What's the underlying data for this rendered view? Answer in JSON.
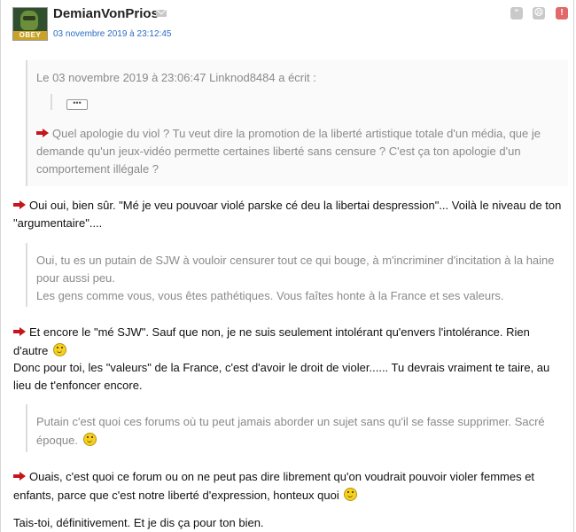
{
  "post": {
    "author": "DemianVonPrios",
    "date": "03 novembre 2019 à 23:12:45",
    "avatar_text": "OBEY",
    "actions": [
      "quote-icon",
      "sad-face-icon",
      "report-icon"
    ],
    "quote1": {
      "header": "Le 03 novembre 2019 à 23:06:47 Linknod8484 a écrit :",
      "collapsed_label": "•••",
      "text": "Quel apologie du viol ? Tu veut dire la promotion de la liberté artistique totale d'un média, que je demande qu'un jeux-vidéo permette certaines liberté sans censure ? C'est ça ton apologie d'un comportement illégale ?"
    },
    "para1": "Oui oui, bien sûr. \"Mé je veu pouvoar violé parske cé deu la libertai despression\"... Voilà le niveau de ton \"argumentaire\"....",
    "quote2": {
      "line1": "Oui, tu es un putain de SJW à vouloir censurer tout ce qui bouge, à m'incriminer d'incitation à la haine pour aussi peu.",
      "line2": "Les gens comme vous, vous êtes pathétiques. Vous faîtes honte à la France et ses valeurs."
    },
    "para2": "Et encore le \"mé SJW\". Sauf que non, je ne suis seulement intolérant qu'envers l'intolérance. Rien d'autre",
    "para3": "Donc pour toi, les \"valeurs\" de la France, c'est d'avoir le droit de violer...... Tu devrais vraiment te taire, au lieu de t'enfoncer encore.",
    "quote3": {
      "text": "Putain c'est quoi ces forums où tu peut jamais aborder un sujet sans qu'il se fasse supprimer. Sacré époque."
    },
    "para4": "Ouais, c'est quoi ce forum ou on ne peut pas dire librement qu'on voudrait pouvoir violer femmes et enfants, parce que c'est notre liberté d'expression, honteux quoi",
    "para5": "Tais-toi, définitivement. Et je dis ça pour ton bien."
  }
}
